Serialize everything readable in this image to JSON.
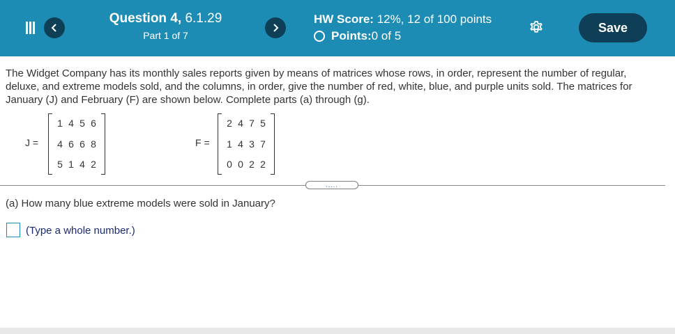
{
  "header": {
    "question_title_bold": "Question 4,",
    "question_id": " 6.1.29",
    "part_label": "Part 1 of 7",
    "hw_score_label": "HW Score:",
    "hw_score_value": " 12%, 12 of 100 points",
    "points_label": "Points:",
    "points_value": " 0 of 5",
    "save_label": "Save"
  },
  "problem": {
    "text": "The Widget Company has its monthly sales reports given by means of matrices whose rows, in order, represent the number of regular, deluxe, and extreme models sold, and the columns, in order, give the number of red, white, blue, and purple units sold. The matrices for January (J) and February (F) are shown below. Complete parts (a) through (g).",
    "matrix_j": {
      "label": "J =",
      "rows": [
        [
          "1",
          "4",
          "5",
          "6"
        ],
        [
          "4",
          "6",
          "6",
          "8"
        ],
        [
          "5",
          "1",
          "4",
          "2"
        ]
      ]
    },
    "matrix_f": {
      "label": "F =",
      "rows": [
        [
          "2",
          "4",
          "7",
          "5"
        ],
        [
          "1",
          "4",
          "3",
          "7"
        ],
        [
          "0",
          "0",
          "2",
          "2"
        ]
      ]
    }
  },
  "expand_button": {
    "label": "....."
  },
  "part_a": {
    "question": "(a) How many blue extreme models were sold in January?",
    "hint": "(Type a whole number.)"
  },
  "colors": {
    "header_bg": "#1d8cb4",
    "button_dark": "#0f3f57",
    "hint_text": "#1a2b6d"
  }
}
